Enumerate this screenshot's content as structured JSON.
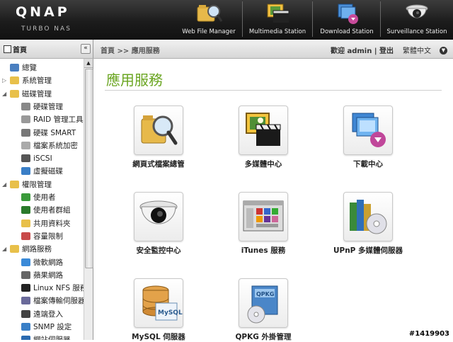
{
  "brand": {
    "logo": "QNAP",
    "sub": "TURBO NAS"
  },
  "apps": [
    {
      "label": "Web File Manager",
      "icon": "folder-magnifier-icon"
    },
    {
      "label": "Multimedia Station",
      "icon": "multimedia-icon"
    },
    {
      "label": "Download Station",
      "icon": "download-icon"
    },
    {
      "label": "Surveillance Station",
      "icon": "camera-icon"
    }
  ],
  "nav": {
    "side_title": "首頁",
    "collapse": "«",
    "breadcrumb_home": "首頁",
    "breadcrumb_sep": ">>",
    "breadcrumb_current": "應用服務",
    "welcome": "歡迎 admin",
    "logout": "登出",
    "divider": "|",
    "language": "繁體中文"
  },
  "sidebar": {
    "items": [
      {
        "label": "總覽",
        "level": 0,
        "icon": "overview-icon"
      },
      {
        "label": "系統管理",
        "level": 0,
        "icon": "folder-icon",
        "expanded": false
      },
      {
        "label": "磁碟管理",
        "level": 0,
        "icon": "folder-open-icon",
        "expanded": true
      },
      {
        "label": "硬碟管理",
        "level": 1,
        "icon": "disk-icon"
      },
      {
        "label": "RAID 管理工具",
        "level": 1,
        "icon": "raid-icon"
      },
      {
        "label": "硬碟 SMART",
        "level": 1,
        "icon": "smart-icon"
      },
      {
        "label": "檔案系統加密",
        "level": 1,
        "icon": "encrypt-icon"
      },
      {
        "label": "iSCSI",
        "level": 1,
        "icon": "iscsi-icon"
      },
      {
        "label": "虛擬磁碟",
        "level": 1,
        "icon": "virtual-disk-icon"
      },
      {
        "label": "權限管理",
        "level": 0,
        "icon": "folder-open-icon",
        "expanded": true
      },
      {
        "label": "使用者",
        "level": 1,
        "icon": "user-icon"
      },
      {
        "label": "使用者群組",
        "level": 1,
        "icon": "group-icon"
      },
      {
        "label": "共用資料夾",
        "level": 1,
        "icon": "share-folder-icon"
      },
      {
        "label": "容量限制",
        "level": 1,
        "icon": "quota-icon"
      },
      {
        "label": "網路服務",
        "level": 0,
        "icon": "folder-open-icon",
        "expanded": true
      },
      {
        "label": "微軟網路",
        "level": 1,
        "icon": "windows-icon"
      },
      {
        "label": "蘋果網路",
        "level": 1,
        "icon": "apple-icon"
      },
      {
        "label": "Linux NFS 服務",
        "level": 1,
        "icon": "linux-icon"
      },
      {
        "label": "檔案傳輸伺服器",
        "level": 1,
        "icon": "ftp-icon"
      },
      {
        "label": "遠端登入",
        "level": 1,
        "icon": "telnet-icon"
      },
      {
        "label": "SNMP 設定",
        "level": 1,
        "icon": "snmp-icon"
      },
      {
        "label": "網站伺服器",
        "level": 1,
        "icon": "web-icon"
      }
    ]
  },
  "main": {
    "title": "應用服務",
    "tiles": [
      {
        "label": "網頁式檔案總管",
        "icon": "folder-magnifier-icon"
      },
      {
        "label": "多媒體中心",
        "icon": "multimedia-icon"
      },
      {
        "label": "下載中心",
        "icon": "download-icon"
      },
      {
        "label": "安全監控中心",
        "icon": "camera-icon"
      },
      {
        "label": "iTunes 服務",
        "icon": "itunes-icon"
      },
      {
        "label": "UPnP 多媒體伺服器",
        "icon": "upnp-icon"
      },
      {
        "label": "MySQL 伺服器",
        "icon": "mysql-icon"
      },
      {
        "label": "QPKG 外掛管理",
        "icon": "qpkg-icon"
      }
    ]
  },
  "watermark": "#1419903",
  "colors": {
    "title_green": "#6aa521",
    "header_dark": "#1c1c1c"
  }
}
